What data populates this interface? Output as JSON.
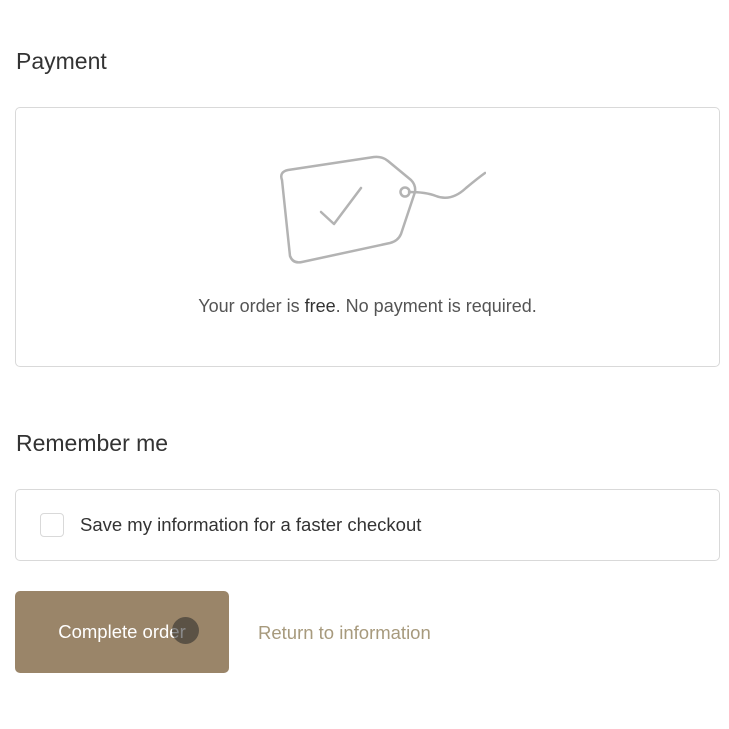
{
  "payment": {
    "title": "Payment",
    "message_prefix": "Your order is ",
    "message_emphasis": "free",
    "message_suffix": ". No payment is required.",
    "icon": "price-tag-check-icon"
  },
  "remember_me": {
    "title": "Remember me",
    "checkbox_label": "Save my information for a faster checkout",
    "checked": false
  },
  "actions": {
    "complete_label": "Complete order",
    "return_label": "Return to information"
  },
  "colors": {
    "button_bg": "#9a8569",
    "link": "#a79a7d",
    "border": "#d9d9d9",
    "text": "#333333"
  }
}
